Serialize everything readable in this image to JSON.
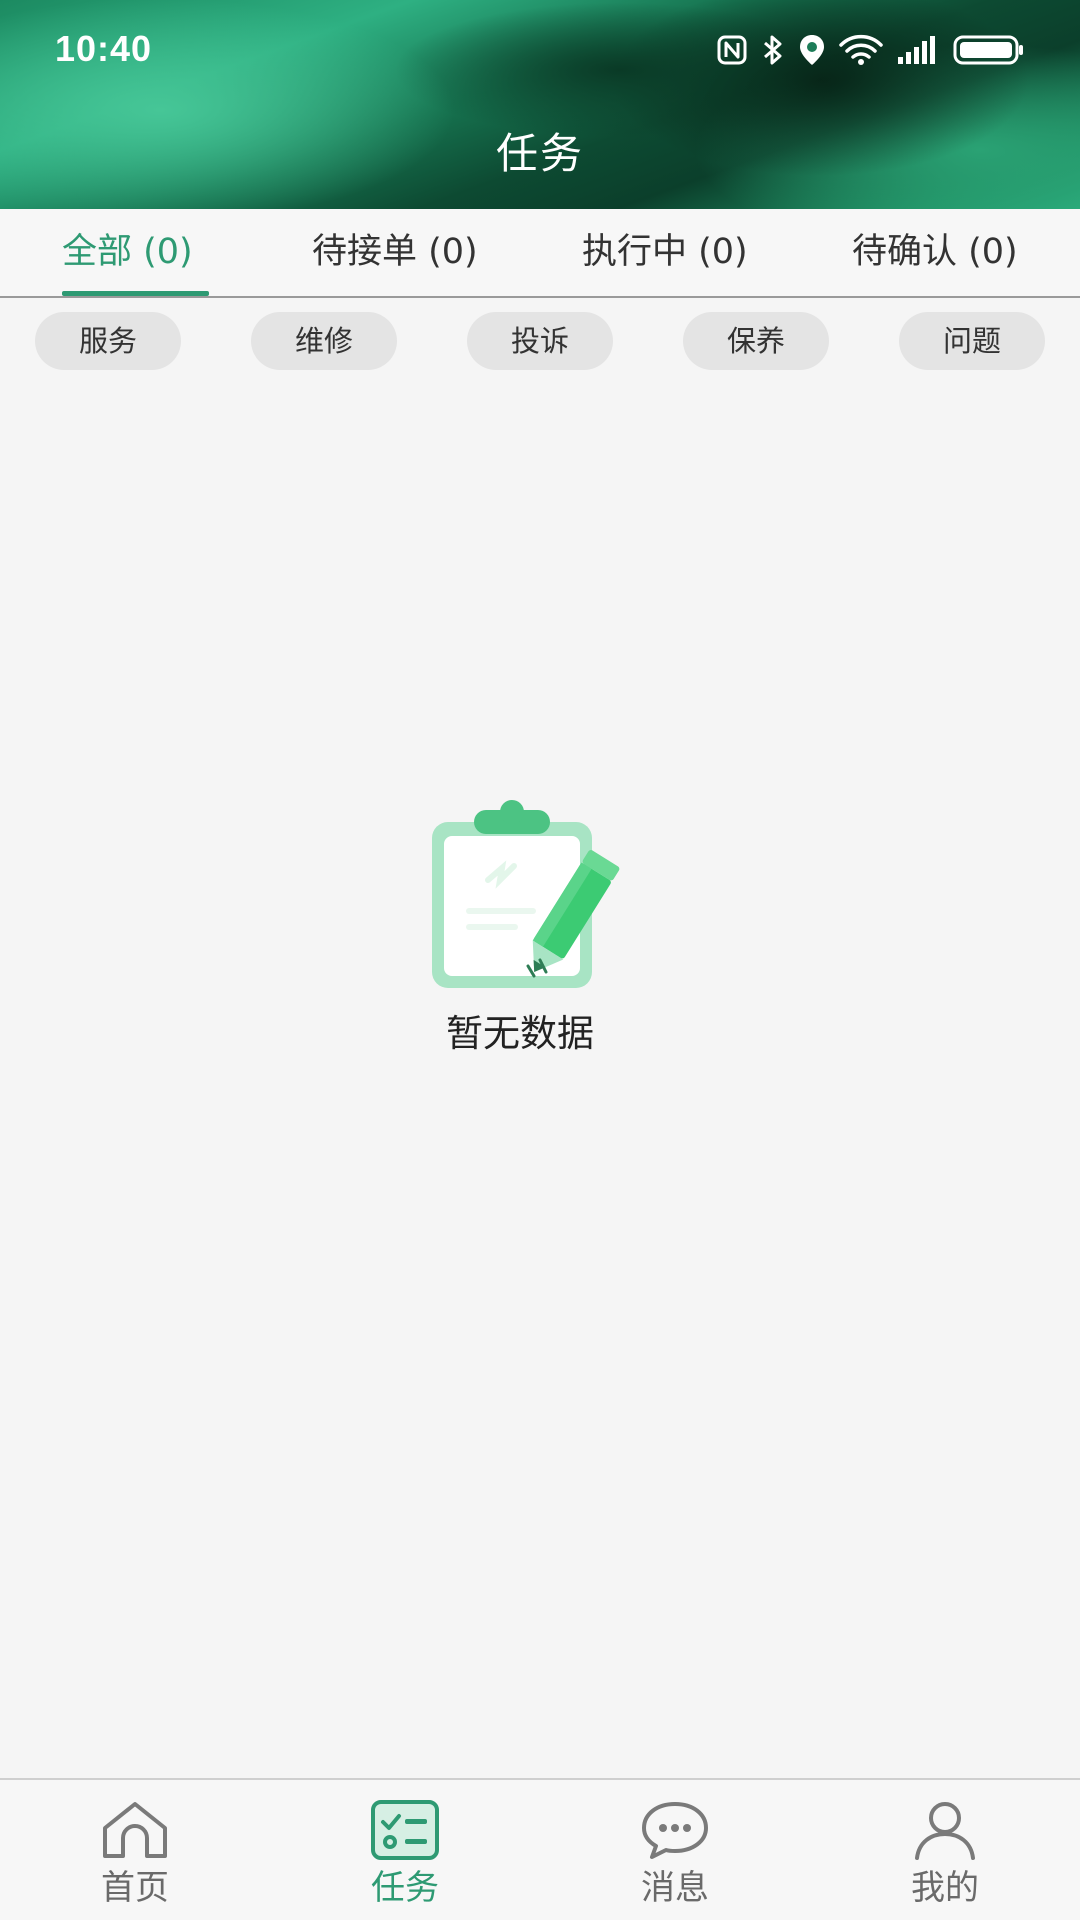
{
  "status_bar": {
    "time": "10:40",
    "icons": [
      "nfc-icon",
      "bluetooth-icon",
      "location-icon",
      "wifi-icon",
      "signal-icon",
      "battery-icon"
    ]
  },
  "header": {
    "title": "任务"
  },
  "tabs": [
    {
      "label": "全部 (0)",
      "active": true
    },
    {
      "label": "待接单 (0)",
      "active": false
    },
    {
      "label": "执行中 (0)",
      "active": false
    },
    {
      "label": "待确认 (0)",
      "active": false
    }
  ],
  "filters": [
    {
      "label": "服务"
    },
    {
      "label": "维修"
    },
    {
      "label": "投诉"
    },
    {
      "label": "保养"
    },
    {
      "label": "问题"
    }
  ],
  "empty_state": {
    "text": "暂无数据",
    "icon": "clipboard-pencil-icon"
  },
  "bottom_nav": [
    {
      "label": "首页",
      "icon": "home-icon",
      "active": false
    },
    {
      "label": "任务",
      "icon": "task-list-icon",
      "active": true
    },
    {
      "label": "消息",
      "icon": "chat-bubble-icon",
      "active": false
    },
    {
      "label": "我的",
      "icon": "user-icon",
      "active": false
    }
  ],
  "colors": {
    "accent": "#2e9a73",
    "background": "#f5f5f5",
    "chip_background": "#e4e4e4"
  }
}
